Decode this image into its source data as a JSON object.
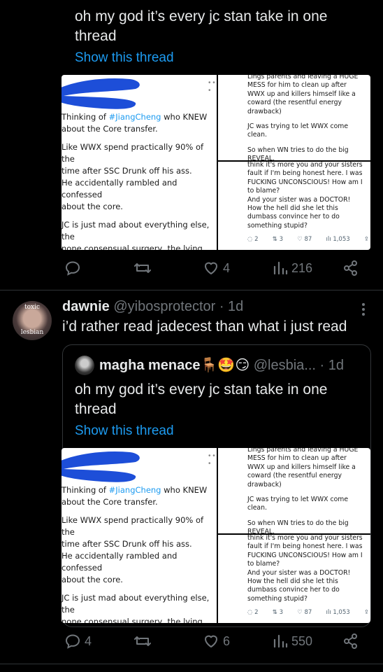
{
  "top_tweet": {
    "text": "oh my god it’s every jc stan take in one thread",
    "show_thread": "Show this thread",
    "stats": {
      "replies": "",
      "retweets": "",
      "likes": "4",
      "views": "216"
    }
  },
  "screenshot": {
    "left_hashtag": "#JiangCheng",
    "left_p1_pre": "Thinking of ",
    "left_p1_post": " who KNEW\nabout the Core transfer.",
    "left_p2": "Like WWX spend practically 90% of the\ntime after SSC Drunk off his ass.\nHe accidentally rambled and confessed\nabout the core.",
    "left_p3": "JC is just mad about everything else, the\nnone consensual surgery, the lying, doing\nshit",
    "rt_p1": "Lings parents and leaving a HUGE MESS for him to clean up after WWX up and killers himself like a coward (the resentful energy drawback)",
    "rt_p2": "JC was trying to let WWX come clean.",
    "rt_p3": "So when WN tries to do the big REVEAL.",
    "rb_p1": "think it's more you and your sisters fault if I'm being honest here. I was FUCKING UNCONSCIOUS! How am I to blame?\nAnd your sister was a DOCTOR! How the hell did she let this dumbass convince her to do something stupid?",
    "rb_stats": {
      "replies": "2",
      "retweets": "3",
      "likes": "87",
      "views": "1,053"
    }
  },
  "reply_tweet": {
    "avatar_text_top": "toxic",
    "avatar_text_bottom": "lesbian",
    "display_name": "dawnie",
    "handle": "@yibosprotector",
    "time": "· 1d",
    "text": "i’d rather read jadecest than what i just read",
    "quoted": {
      "display_name": "magha menace",
      "emojis": "🪑🤩😏",
      "handle": "@lesbia...",
      "time": "· 1d",
      "text": "oh my god it’s every jc stan take in one thread",
      "show_thread": "Show this thread"
    },
    "stats": {
      "replies": "4",
      "retweets": "",
      "likes": "6",
      "views": "550"
    }
  },
  "colors": {
    "link": "#1d9bf0",
    "muted": "#71767b",
    "background": "#000000",
    "text": "#e7e9ea"
  }
}
